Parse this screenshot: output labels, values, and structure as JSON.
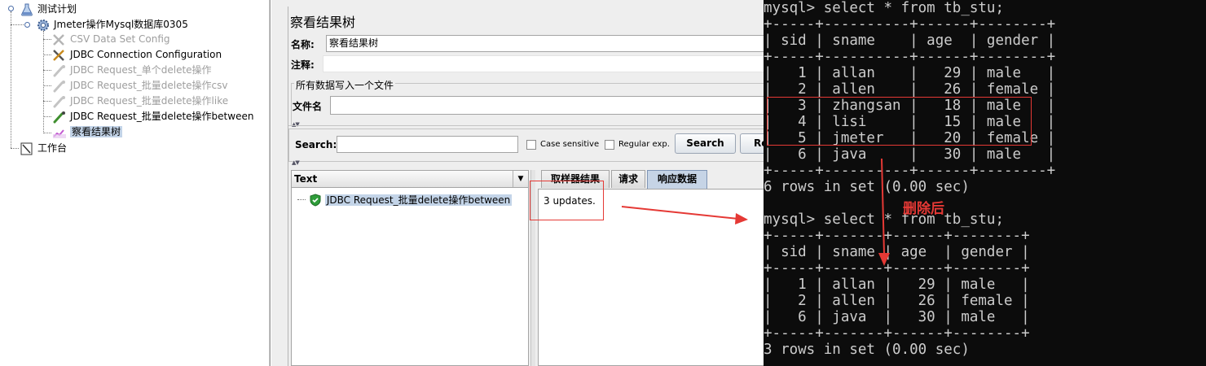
{
  "tree": {
    "items": [
      {
        "label": "测试计划",
        "icon": "test-plan-icon",
        "state": "normal"
      },
      {
        "label": "Jmeter操作Mysql数据库0305",
        "icon": "thread-group-gear-icon",
        "state": "normal"
      },
      {
        "label": "CSV Data Set Config",
        "icon": "wrench-icon",
        "state": "disabled"
      },
      {
        "label": "JDBC Connection Configuration",
        "icon": "wrench-icon",
        "state": "normal"
      },
      {
        "label": "JDBC Request_单个delete操作",
        "icon": "pipette-icon",
        "state": "disabled"
      },
      {
        "label": "JDBC Request_批量delete操作csv",
        "icon": "pipette-icon",
        "state": "disabled"
      },
      {
        "label": "JDBC Request_批量delete操作like",
        "icon": "pipette-icon",
        "state": "disabled"
      },
      {
        "label": "JDBC Request_批量delete操作between",
        "icon": "pipette-icon",
        "state": "normal"
      },
      {
        "label": "察看结果树",
        "icon": "results-tree-icon",
        "state": "selected"
      },
      {
        "label": "工作台",
        "icon": "workbench-icon",
        "state": "normal"
      }
    ]
  },
  "panel": {
    "title": "察看结果树",
    "name_label": "名称:",
    "name_value": "察看结果树",
    "comment_label": "注释:",
    "comment_value": "",
    "write_all_label": "所有数据写入一个文件",
    "filename_label": "文件名",
    "filename_value": ""
  },
  "search": {
    "label": "Search:",
    "value": "",
    "case_sensitive": "Case sensitive",
    "regular_exp": "Regular exp.",
    "search_button": "Search",
    "reset_button": "Re"
  },
  "results": {
    "renderer": "Text",
    "sample": "JDBC Request_批量delete操作between",
    "tabs": [
      "取样器结果",
      "请求",
      "响应数据"
    ],
    "active_tab": 2,
    "response_text": "3 updates."
  },
  "terminal": {
    "lines": [
      "mysql> select * from tb_stu;",
      "+-----+----------+------+--------+",
      "| sid | sname    | age  | gender |",
      "+-----+----------+------+--------+",
      "|   1 | allan    |   29 | male   |",
      "|   2 | allen    |   26 | female |",
      "|   3 | zhangsan |   18 | male   |",
      "|   4 | lisi     |   15 | male   |",
      "|   5 | jmeter   |   20 | female |",
      "|   6 | java     |   30 | male   |",
      "+-----+----------+------+--------+",
      "6 rows in set (0.00 sec)",
      "",
      "mysql> select * from tb_stu;",
      "+-----+-------+------+--------+",
      "| sid | sname | age  | gender |",
      "+-----+-------+------+--------+",
      "|   1 | allan |   29 | male   |",
      "|   2 | allen |   26 | female |",
      "|   6 | java  |   30 | male   |",
      "+-----+-------+------+--------+",
      "3 rows in set (0.00 sec)"
    ]
  },
  "annotation": {
    "after_delete": "删除后",
    "color": "#e53935"
  }
}
